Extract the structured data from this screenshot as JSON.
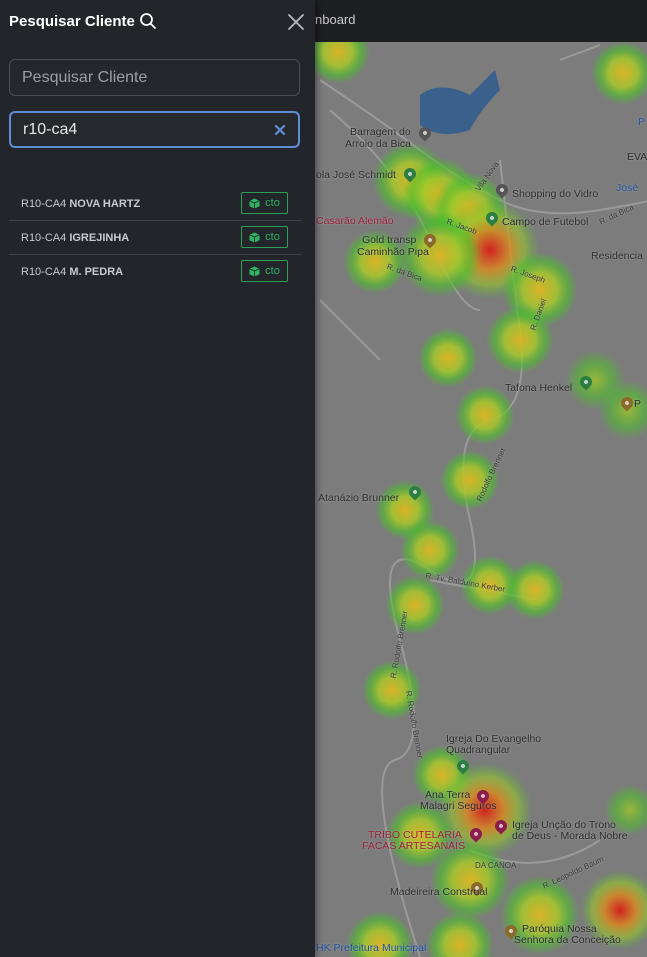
{
  "topbar": {
    "partial_label": "nboard"
  },
  "sidebar": {
    "title": "Pesquisar Cliente",
    "search_placeholder": "Pesquisar Cliente",
    "search_value": "r10-ca4",
    "results": [
      {
        "prefix": "R10-CA4",
        "name": "NOVA HARTZ",
        "button": "cto"
      },
      {
        "prefix": "R10-CA4",
        "name": "IGREJINHA",
        "button": "cto"
      },
      {
        "prefix": "R10-CA4",
        "name": "M. PEDRA",
        "button": "cto"
      }
    ]
  },
  "map": {
    "labels": {
      "barragem1": "Barragem do",
      "barragem2": "Arroio da Bica",
      "jose_schmidt": "ola José Schmidt",
      "shopping": "Shopping do Vidro",
      "campo": "Campo de Futebol",
      "casarao": "Casarão Alemão",
      "gold1": "Gold transp",
      "gold2": "Caminhão Pipa",
      "residencia": "Residencia",
      "tafona": "Tafona Henkel",
      "atanazio": "Atanázio Brunner",
      "igreja1": "Igreja Do Evangelho",
      "igreja2": "Quadrangular",
      "ana1": "Ana Terra",
      "ana2": "Malagri Seguros",
      "uncao1": "Igreja Unção do Trono",
      "uncao2": "de Deus - Morada Nobre",
      "tribo1": "TRIBO CUTELARIA",
      "tribo2": "FACAS ARTESANAIS",
      "dacanoa": "DA CANOA",
      "madeireira": "Madeireira Construal",
      "paroquia1": "Paróquia Nossa",
      "paroquia2": "Senhora da Conceição",
      "prefeitura": "HK Prefeitura Municipal",
      "eva": "EVA",
      "jose_r": "José",
      "p1": "P",
      "p2": "P",
      "road_dabica": "R. da Bica",
      "road_jacob": "R. Jacob",
      "road_dabica2": "R. da Bica",
      "road_joseph": "R. Joseph",
      "road_vila": "Vila Nova",
      "road_rodolfo": "R. Rodolfo Brenner",
      "road_baldui": "R. Tv. Balduíno Kerber",
      "road_leopoldo": "R. Leopoldo Baum",
      "road_rodolfo2": "R. Rodolfo Brenner",
      "road_daniel": "R. Daniel",
      "road_brenner": "Rodolfo Brenner"
    },
    "colors": {
      "heat_low": "#3fbf2a",
      "heat_mid": "#d6c21e",
      "heat_high": "#d42020"
    }
  }
}
